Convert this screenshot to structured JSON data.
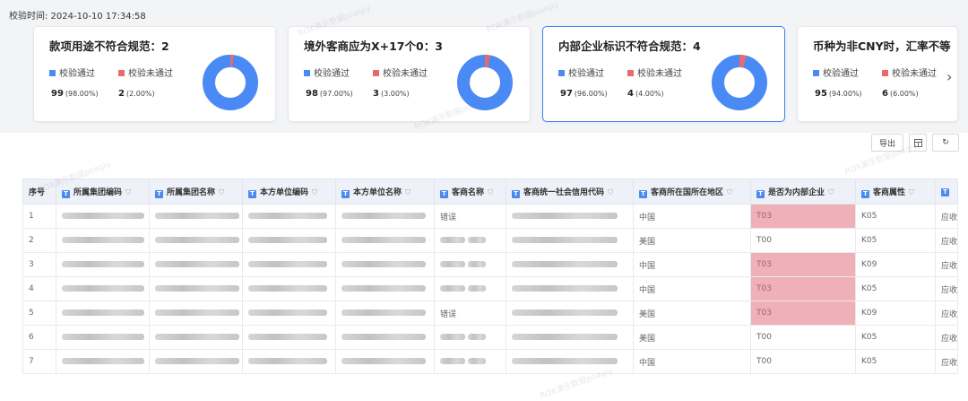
{
  "check_time": "校验时间: 2024-10-10 17:34:58",
  "legend": {
    "pass": "校验通过",
    "fail": "校验未通过"
  },
  "colors": {
    "pass": "#4a8af4",
    "fail": "#e66c6c",
    "highlight": "#f0b0b7",
    "selected_border": "#3b82f6"
  },
  "cards": [
    {
      "title": "款项用途不符合规范：2",
      "pass": "99",
      "pass_pct": "(98.00%)",
      "fail": "2",
      "fail_pct": "(2.00%)",
      "fail_fraction": 0.02
    },
    {
      "title": "境外客商应为X+17个0：3",
      "pass": "98",
      "pass_pct": "(97.00%)",
      "fail": "3",
      "fail_pct": "(3.00%)",
      "fail_fraction": 0.03
    },
    {
      "title": "内部企业标识不符合规范：4",
      "pass": "97",
      "pass_pct": "(96.00%)",
      "fail": "4",
      "fail_pct": "(4.00%)",
      "fail_fraction": 0.04
    },
    {
      "title": "币种为非CNY时，汇率不等",
      "pass": "95",
      "pass_pct": "(94.00%)",
      "fail": "6",
      "fail_pct": "(6.00%)",
      "fail_fraction": 0.06
    }
  ],
  "toolbar": {
    "export": "导出",
    "settings_icon": "grid-icon",
    "refresh_icon": "refresh-icon"
  },
  "table": {
    "headers": [
      "序号",
      "所属集团编码",
      "所属集团名称",
      "本方单位编码",
      "本方单位名称",
      "客商名称",
      "客商统一社会信用代码",
      "客商所在国所在地区",
      "是否为内部企业",
      "客商属性",
      ""
    ],
    "rows": [
      {
        "no": "1",
        "name": "错误",
        "region": "中国",
        "internal": "T03",
        "attr": "K05",
        "tail": "应收",
        "hl": true
      },
      {
        "no": "2",
        "name": "",
        "region": "美国",
        "internal": "T00",
        "attr": "K05",
        "tail": "应收",
        "hl": false
      },
      {
        "no": "3",
        "name": "",
        "region": "中国",
        "internal": "T03",
        "attr": "K09",
        "tail": "应收",
        "hl": true
      },
      {
        "no": "4",
        "name": "",
        "region": "中国",
        "internal": "T03",
        "attr": "K05",
        "tail": "应收",
        "hl": true
      },
      {
        "no": "5",
        "name": "错误",
        "region": "美国",
        "internal": "T03",
        "attr": "K09",
        "tail": "应收",
        "hl": true
      },
      {
        "no": "6",
        "name": "",
        "region": "美国",
        "internal": "T00",
        "attr": "K05",
        "tail": "应收",
        "hl": false
      },
      {
        "no": "7",
        "name": "",
        "region": "中国",
        "internal": "T00",
        "attr": "K05",
        "tail": "应收",
        "hl": false
      }
    ]
  }
}
